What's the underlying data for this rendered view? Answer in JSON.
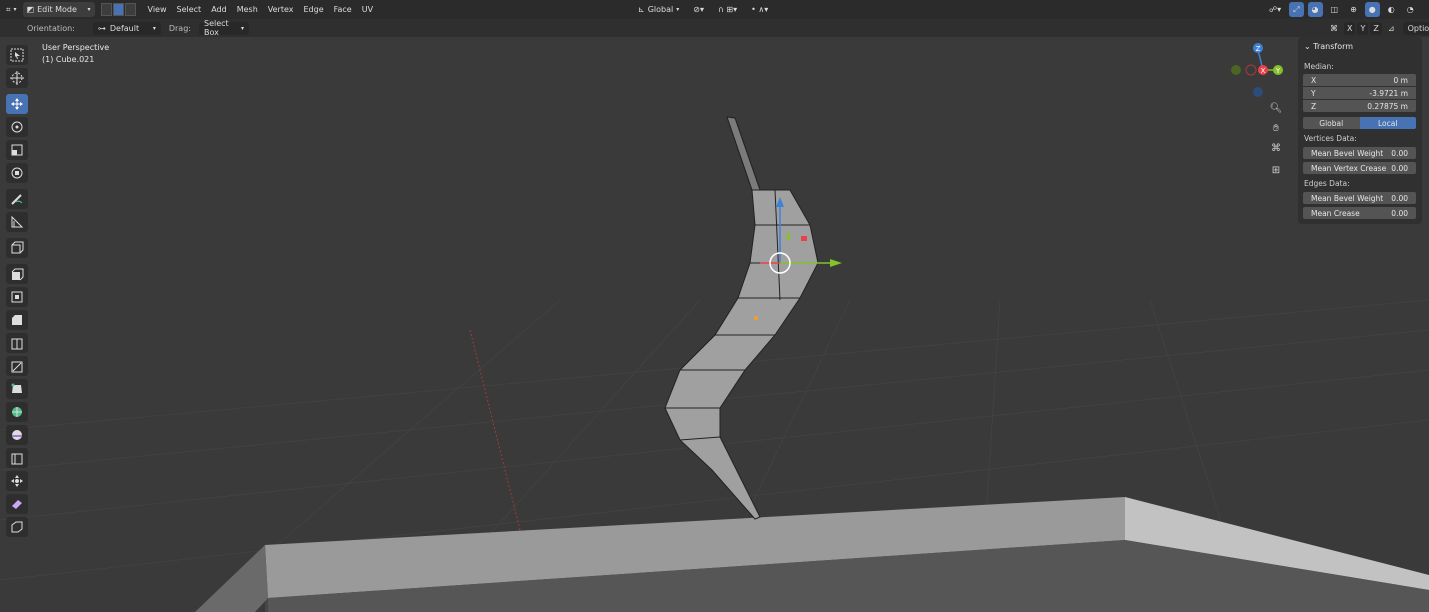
{
  "header": {
    "editor_icon": "editor-type-icon",
    "mode_label": "Edit Mode",
    "menus": [
      "View",
      "Select",
      "Add",
      "Mesh",
      "Vertex",
      "Edge",
      "Face",
      "UV"
    ],
    "transform_orientation": "Global",
    "options_label": "Options"
  },
  "toolsettings": {
    "orientation_label": "Orientation:",
    "orientation_value": "Default",
    "drag_label": "Drag:",
    "drag_value": "Select Box",
    "axes": [
      "X",
      "Y",
      "Z"
    ]
  },
  "viewport": {
    "view_name": "User Perspective",
    "object_name": "(1) Cube.021"
  },
  "gizmo_axes": {
    "z": "Z",
    "y": "Y",
    "x": "X"
  },
  "npanel": {
    "title": "Transform",
    "median_label": "Median:",
    "fields": [
      {
        "label": "X",
        "value": "0 m"
      },
      {
        "label": "Y",
        "value": "-3.9721 m"
      },
      {
        "label": "Z",
        "value": "0.27875 m"
      }
    ],
    "toggle": {
      "global": "Global",
      "local": "Local",
      "active": "Local"
    },
    "vertices_label": "Vertices Data:",
    "vertices_fields": [
      {
        "label": "Mean Bevel Weight",
        "value": "0.00"
      },
      {
        "label": "Mean Vertex Crease",
        "value": "0.00"
      }
    ],
    "edges_label": "Edges Data:",
    "edges_fields": [
      {
        "label": "Mean Bevel Weight",
        "value": "0.00"
      },
      {
        "label": "Mean Crease",
        "value": "0.00"
      }
    ]
  },
  "colors": {
    "accent": "#4772b3",
    "axis_x": "#e8414b",
    "axis_y": "#86c02a",
    "axis_z": "#3d82d6"
  }
}
